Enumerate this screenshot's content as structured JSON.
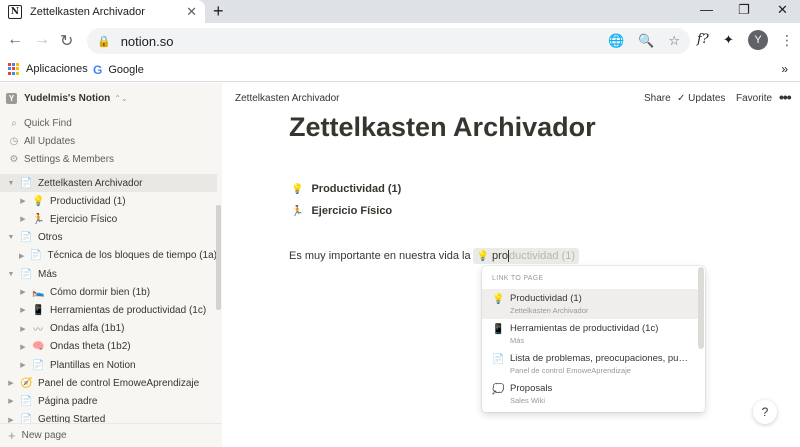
{
  "browser": {
    "tab_title": "Zettelkasten Archivador",
    "tab_logo": "N",
    "tab_close": "✕",
    "new_tab": "+",
    "url": "notion.so",
    "profile_initial": "Y",
    "bookmarks": [
      {
        "label": "Aplicaciones"
      },
      {
        "label": "Google"
      }
    ],
    "bookmarks_more": "»",
    "ext_f": "f?"
  },
  "sidebar": {
    "workspace_initial": "Y",
    "workspace_name": "Yudelmis's Notion",
    "nav": [
      {
        "label": "Quick Find",
        "icon": "search-icon"
      },
      {
        "label": "All Updates",
        "icon": "clock-icon"
      },
      {
        "label": "Settings & Members",
        "icon": "gear-icon"
      }
    ],
    "tree": [
      {
        "label": "Zettelkasten Archivador",
        "indent": 0,
        "emoji": "📄",
        "active": true
      },
      {
        "label": "Productividad (1)",
        "indent": 1,
        "emoji": "💡"
      },
      {
        "label": "Ejercicio Físico",
        "indent": 1,
        "emoji": "🏃"
      },
      {
        "label": "Otros",
        "indent": 0,
        "emoji": "📄"
      },
      {
        "label": "Técnica de los bloques de tiempo (1a)",
        "indent": 1,
        "emoji": "📄"
      },
      {
        "label": "Más",
        "indent": 0,
        "emoji": "📄"
      },
      {
        "label": "Cómo dormir bien (1b)",
        "indent": 1,
        "emoji": "🛌"
      },
      {
        "label": "Herramientas de productividad (1c)",
        "indent": 1,
        "emoji": "📱"
      },
      {
        "label": "Ondas alfa (1b1)",
        "indent": 1,
        "emoji": "〰"
      },
      {
        "label": "Ondas theta (1b2)",
        "indent": 1,
        "emoji": "🧠"
      },
      {
        "label": "Plantillas en Notion",
        "indent": 1,
        "emoji": "📄"
      },
      {
        "label": "Panel de control EmoweAprendizaje",
        "indent": 0,
        "emoji": "🧭"
      },
      {
        "label": "Página padre",
        "indent": 0,
        "emoji": "📄"
      },
      {
        "label": "Getting Started",
        "indent": 0,
        "emoji": "📄"
      }
    ],
    "new_page": "New page"
  },
  "topbar": {
    "breadcrumb": "Zettelkasten Archivador",
    "share": "Share",
    "updates": "Updates",
    "favorite": "Favorite"
  },
  "page": {
    "title": "Zettelkasten Archivador",
    "links": [
      {
        "emoji": "💡",
        "label": "Productividad (1)"
      },
      {
        "emoji": "🏃",
        "label": "Ejercicio Físico"
      }
    ],
    "paragraph_text": "Es muy importante en nuestra vida la",
    "mention_emoji": "💡",
    "mention_typed": "pro",
    "mention_ghost": "ductividad (1)"
  },
  "popup": {
    "header": "LINK TO PAGE",
    "items": [
      {
        "emoji": "💡",
        "title": "Productividad (1)",
        "subtitle": "Zettelkasten Archivador",
        "selected": true
      },
      {
        "emoji": "📱",
        "title": "Herramientas de productividad (1c)",
        "subtitle": "Más"
      },
      {
        "emoji": "📄",
        "title": "Lista de problemas, preocupaciones, pun...",
        "subtitle": "Panel de control EmoweAprendizaje"
      },
      {
        "emoji": "💭",
        "title": "Proposals",
        "subtitle": "Sales Wiki"
      }
    ]
  },
  "help_label": "?"
}
